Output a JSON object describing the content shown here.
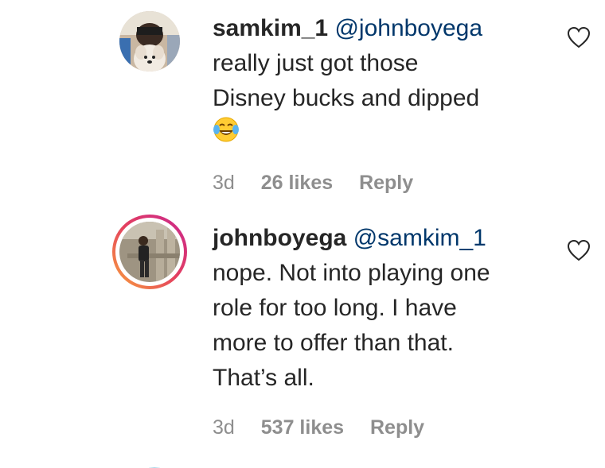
{
  "comments": [
    {
      "username": "samkim_1",
      "mention": "@johnboyega",
      "lines": [
        "really just got those",
        "Disney bucks and dipped"
      ],
      "emoji": "face-with-tears-of-joy",
      "time": "3d",
      "likes": "26 likes",
      "reply": "Reply"
    },
    {
      "username": "johnboyega",
      "mention": "@samkim_1",
      "lines": [
        "nope. Not into playing one",
        "role for too long. I have",
        "more to offer than that.",
        "That’s all."
      ],
      "time": "3d",
      "likes": "537 likes",
      "reply": "Reply"
    }
  ],
  "colors": {
    "text": "#262626",
    "mention": "#00376b",
    "meta": "#8e8e8e",
    "story_ring_start": "#f9a43b",
    "story_ring_end": "#c9268f"
  }
}
